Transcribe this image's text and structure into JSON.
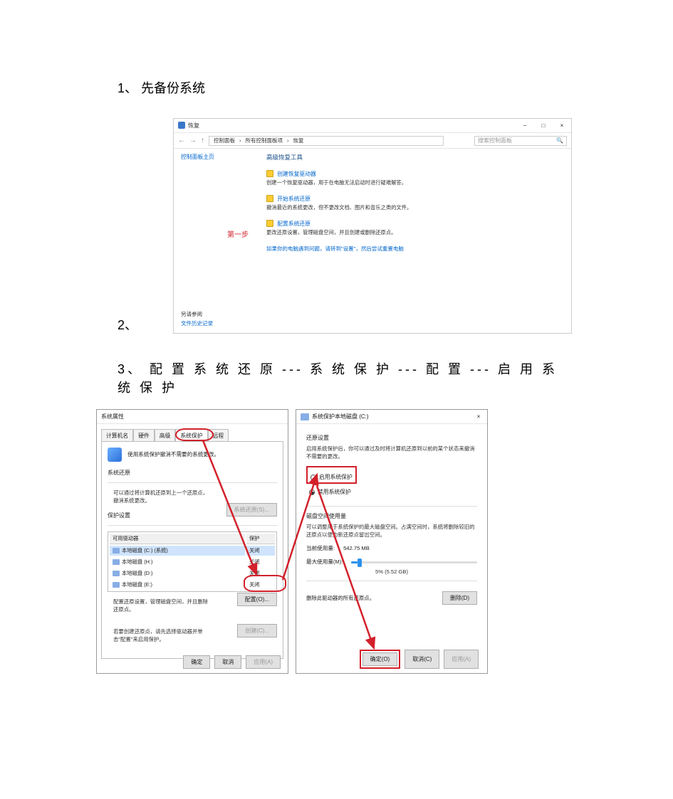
{
  "step1": {
    "label": "1、  先备份系统"
  },
  "step2": {
    "label": "2、"
  },
  "step3": {
    "label": "3、 配 置 系 统 还 原 --- 系 统 保 护 --- 配 置 --- 启 用 系 统 保 护"
  },
  "shot1": {
    "title": "恢复",
    "win": {
      "min": "−",
      "max": "□",
      "close": "×"
    },
    "nav": {
      "back": "←",
      "fwd": "→",
      "up": "↑",
      "crumb1": "控制面板",
      "crumb2": "所有控制面板项",
      "crumb3": "恢复",
      "search_placeholder": "搜索控制面板",
      "search_icon": "🔍"
    },
    "left_link": "控制面板主页",
    "heading": "高级恢复工具",
    "items": [
      {
        "link": "创建恢复驱动器",
        "desc": "创建一个恢复驱动器，用于在电脑无法启动时进行疑难解答。"
      },
      {
        "link": "开始系统还原",
        "desc": "撤消最近的系统更改，但不更改文档、图片和音乐之类的文件。"
      },
      {
        "link": "配置系统还原",
        "desc": "更改还原设置，管理磁盘空间，并且创建或删除还原点。"
      }
    ],
    "blue_note": "如果你的电脑遇到问题，请转到\"设置\"，然后尝试重置电脑",
    "step_label": "第一步",
    "also_title": "另请参阅",
    "also_link": "文件历史记录"
  },
  "dlgA": {
    "title": "系统属性",
    "tabs": [
      "计算机名",
      "硬件",
      "高级",
      "系统保护",
      "远程"
    ],
    "intro": "使用系统保护撤消不需要的系统更改。",
    "restore_title": "系统还原",
    "restore_desc": "可以通过将计算机还原到上一个还原点，撤消系统更改。",
    "btn_sysrestore": "系统还原(S)...",
    "prot_title": "保护设置",
    "drives_header": {
      "col1": "可用驱动器",
      "col2": "保护"
    },
    "drives": [
      {
        "name": "本地磁盘 (C:) (系统)",
        "state": "关闭"
      },
      {
        "name": "本地磁盘 (H:)",
        "state": "关闭"
      },
      {
        "name": "本地磁盘 (D:)",
        "state": "关闭"
      },
      {
        "name": "本地磁盘 (E:)",
        "state": "关闭"
      }
    ],
    "cfg_desc": "配置还原设置，管理磁盘空间，并且删除还原点。",
    "btn_configure": "配置(O)...",
    "create_desc": "若要创建还原点，请先选择驱动器并单击\"配置\"来启用保护。",
    "btn_create": "创建(C)...",
    "btn_ok": "确定",
    "btn_cancel": "取消",
    "btn_apply": "应用(A)"
  },
  "dlgB": {
    "title": "系统保护本地磁盘 (C:)",
    "restore_title": "还原设置",
    "restore_desc": "启用系统保护后，你可以通过及时将计算机还原到以前的某个状态来撤消不需要的更改。",
    "radio_on": "启用系统保护",
    "radio_off": "禁用系统保护",
    "disk_title": "磁盘空间使用量",
    "disk_desc": "可以调整用于系统保护的最大磁盘空间。占满空间时，系统将删除较旧的还原点以便为新还原点留出空间。",
    "current_label": "当前使用量:",
    "current_value": "542.75 MB",
    "max_label": "最大使用量(M):",
    "pct": "5% (5.52 GB)",
    "slider_pct": 5,
    "del_desc": "删除此驱动器的所有还原点。",
    "btn_delete": "删除(D)",
    "btn_ok": "确定(O)",
    "btn_cancel": "取消(C)",
    "btn_apply": "应用(A)"
  }
}
